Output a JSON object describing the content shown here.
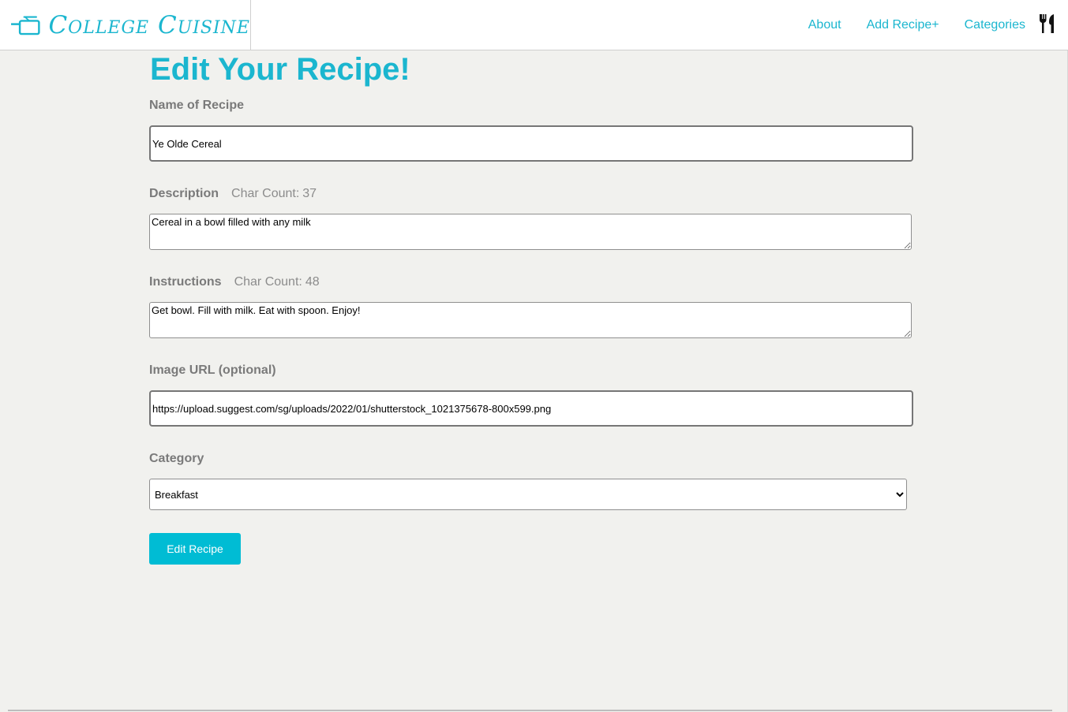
{
  "brand": {
    "name": "College Cuisine",
    "logo_icon": "pot-icon",
    "accent_color": "#1bb6cf"
  },
  "nav": {
    "links": [
      "About",
      "Add Recipe+",
      "Categories"
    ],
    "utensils_icon": "fork-knife-icon"
  },
  "page": {
    "title": "Edit Your Recipe!"
  },
  "form": {
    "name": {
      "label": "Name of Recipe",
      "value": "Ye Olde Cereal"
    },
    "description": {
      "label": "Description",
      "char_count_label": "Char Count:",
      "char_count": "37",
      "value": "Cereal in a bowl filled with any milk"
    },
    "instructions": {
      "label": "Instructions",
      "char_count_label": "Char Count:",
      "char_count": "48",
      "value": "Get bowl. Fill with milk. Eat with spoon. Enjoy!"
    },
    "image_url": {
      "label": "Image URL (optional)",
      "value": "https://upload.suggest.com/sg/uploads/2022/01/shutterstock_1021375678-800x599.png"
    },
    "category": {
      "label": "Category",
      "selected": "Breakfast"
    },
    "submit_label": "Edit Recipe",
    "button_color": "#00bcd4"
  }
}
